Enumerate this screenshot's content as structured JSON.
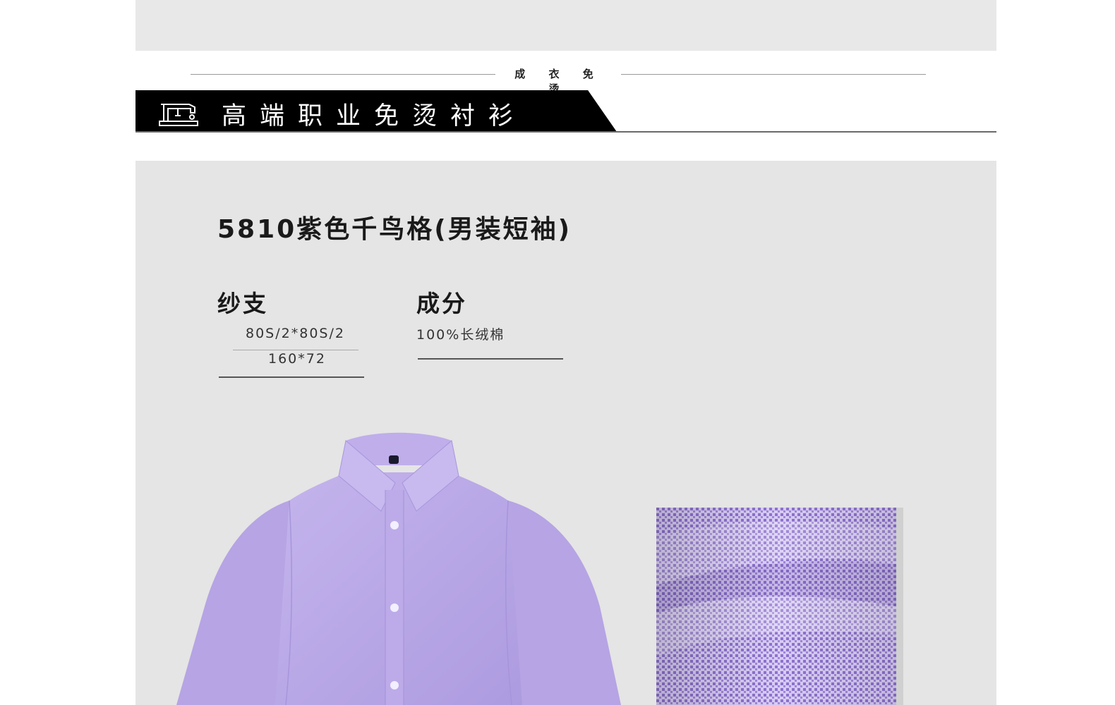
{
  "header": {
    "subtitle": "成 衣 免 烫",
    "banner_title": "高端职业免烫衬衫"
  },
  "product": {
    "title": "5810紫色千鸟格(男装短袖)",
    "specs": {
      "yarn_label": "纱支",
      "yarn_count": "80S/2*80S/2",
      "thread_density": "160*72",
      "composition_label": "成分",
      "composition_value": "100%长绒棉"
    }
  },
  "images": {
    "shirt": "purple-short-sleeve-shirt",
    "fabric": "purple-houndstooth-fabric-swatch"
  },
  "colors": {
    "shirt_purple": "#b9a7e6",
    "banner_black": "#000000",
    "panel_gray": "#e5e5e5"
  }
}
